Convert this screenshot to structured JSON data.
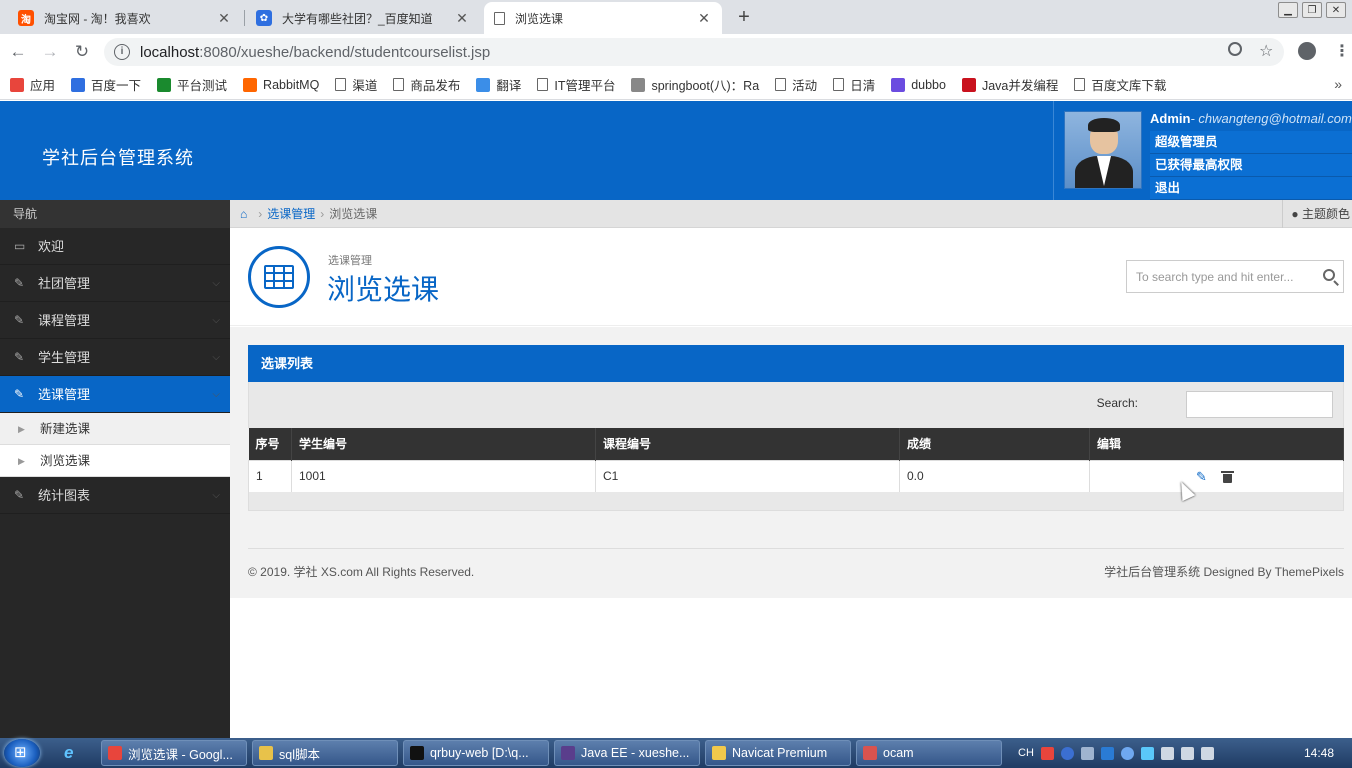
{
  "browser": {
    "tabs": [
      {
        "title": "淘宝网 - 淘！我喜欢",
        "icon": "taobao-icon",
        "color": "#ff5000",
        "glyph": "淘"
      },
      {
        "title": "大学有哪些社团？_百度知道",
        "icon": "baidu-paw-icon",
        "color": "#2f6fe0",
        "glyph": "✿"
      },
      {
        "title": "浏览选课",
        "icon": "page-icon",
        "color": "#ffffff",
        "glyph": ""
      }
    ],
    "new_tab_label": "+",
    "url_host": "localhost",
    "url_rest": ":8080/xueshe/backend/studentcourselist.jsp",
    "bookmarks": [
      {
        "label": "应用",
        "icon": "apps-grid-icon",
        "color": "#e8453c"
      },
      {
        "label": "百度一下",
        "icon": "baidu-paw-icon",
        "color": "#2f6fe0"
      },
      {
        "label": "平台测试",
        "icon": "globe-icon",
        "color": "#1a8a2e"
      },
      {
        "label": "RabbitMQ",
        "icon": "rabbitmq-icon",
        "color": "#ff6600"
      },
      {
        "label": "渠道",
        "icon": "page-icon",
        "color": "doc"
      },
      {
        "label": "商品发布",
        "icon": "page-icon",
        "color": "doc"
      },
      {
        "label": "翻译",
        "icon": "translate-icon",
        "color": "#3b8ee8"
      },
      {
        "label": "IT管理平台",
        "icon": "page-icon",
        "color": "doc"
      },
      {
        "label": "springboot(八)：Ra",
        "icon": "blog-icon",
        "color": "#888888"
      },
      {
        "label": "活动",
        "icon": "page-icon",
        "color": "doc"
      },
      {
        "label": "日清",
        "icon": "page-icon",
        "color": "doc"
      },
      {
        "label": "dubbo",
        "icon": "dubbo-icon",
        "color": "#6b4ce0"
      },
      {
        "label": "Java并发编程",
        "icon": "csdn-icon",
        "color": "#c9121e"
      },
      {
        "label": "百度文库下载",
        "icon": "page-icon",
        "color": "doc"
      }
    ],
    "bookmarks_more": "»"
  },
  "app": {
    "title": "学社后台管理系统",
    "user": {
      "name": "Admin",
      "email": "- chwangteng@hotmail.com",
      "links": [
        "超级管理员",
        "已获得最高权限",
        "退出"
      ]
    },
    "nav_header": "导航",
    "nav": [
      {
        "label": "欢迎",
        "icon": "laptop-icon",
        "active": false,
        "caret": false
      },
      {
        "label": "社团管理",
        "icon": "pencil-icon",
        "active": false,
        "caret": true
      },
      {
        "label": "课程管理",
        "icon": "pencil-icon",
        "active": false,
        "caret": true
      },
      {
        "label": "学生管理",
        "icon": "pencil-icon",
        "active": false,
        "caret": true
      },
      {
        "label": "选课管理",
        "icon": "pencil-icon",
        "active": true,
        "caret": true
      }
    ],
    "sub_nav": [
      "新建选课",
      "浏览选课"
    ],
    "nav_after": {
      "label": "统计图表",
      "icon": "pencil-icon"
    },
    "breadcrumb": {
      "parent": "选课管理",
      "current": "浏览选课"
    },
    "theme_color_label": "主题颜色",
    "page_subtitle": "选课管理",
    "page_title": "浏览选课",
    "search_placeholder": "To search type and hit enter...",
    "widget_title": "选课列表",
    "table_search_label": "Search:",
    "table_search_value": "",
    "columns": [
      "序号",
      "学生编号",
      "课程编号",
      "成绩",
      "编辑"
    ],
    "rows": [
      {
        "index": "1",
        "student": "1001",
        "course": "C1",
        "score": "0.0"
      }
    ],
    "footer_left": "© 2019. 学社 XS.com All Rights Reserved.",
    "footer_right": "学社后台管理系统  Designed By ThemePixels"
  },
  "taskbar": {
    "tasks": [
      {
        "label": "浏览选课 - Googl...",
        "color": "#e8453c"
      },
      {
        "label": "sql脚本",
        "color": "#e8c24a"
      },
      {
        "label": "qrbuy-web [D:\\q...",
        "color": "#111111"
      },
      {
        "label": "Java EE - xueshe...",
        "color": "#5a3e8c"
      },
      {
        "label": "Navicat Premium",
        "color": "#f2c94c"
      },
      {
        "label": "ocam",
        "color": "#d9534f"
      }
    ],
    "ime": "CH",
    "clock": "14:48"
  },
  "colors": {
    "primary": "#0866c6",
    "sidebar_bg": "#272727",
    "table_head": "#333333"
  }
}
